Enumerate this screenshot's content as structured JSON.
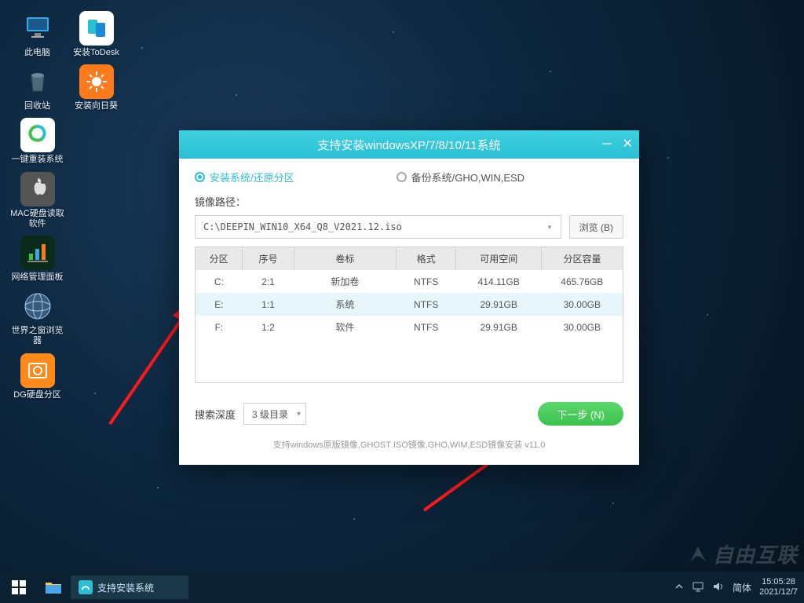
{
  "desktop_icons": [
    {
      "id": "pc",
      "label": "此电脑",
      "bg": "",
      "svg": "monitor"
    },
    {
      "id": "todesk",
      "label": "安装ToDesk",
      "bg": "#ffffff",
      "svg": "todesk"
    },
    {
      "id": "recycle",
      "label": "回收站",
      "bg": "",
      "svg": "bin"
    },
    {
      "id": "sunflower",
      "label": "安装向日葵",
      "bg": "#ff7a1a",
      "svg": "sun"
    },
    {
      "id": "reinstall",
      "label": "一键重装系统",
      "bg": "#ffffff",
      "svg": "swirl"
    },
    {
      "id": "",
      "label": "",
      "bg": "",
      "svg": ""
    },
    {
      "id": "macdisk",
      "label": "MAC硬盘读取软件",
      "bg": "#555",
      "svg": "apple"
    },
    {
      "id": "",
      "label": "",
      "bg": "",
      "svg": ""
    },
    {
      "id": "netpanel",
      "label": "网络管理面板",
      "bg": "#0a2a1a",
      "svg": "bars"
    },
    {
      "id": "",
      "label": "",
      "bg": "",
      "svg": ""
    },
    {
      "id": "browser",
      "label": "世界之窗浏览器",
      "bg": "",
      "svg": "globe"
    },
    {
      "id": "",
      "label": "",
      "bg": "",
      "svg": ""
    },
    {
      "id": "dg",
      "label": "DG硬盘分区",
      "bg": "#ff8a1a",
      "svg": "dg"
    }
  ],
  "dialog": {
    "title": "支持安装windowsXP/7/8/10/11系统",
    "radio_install": "安装系统/还原分区",
    "radio_backup": "备份系统/GHO,WIN,ESD",
    "path_label": "镜像路径：",
    "path_value": "C:\\DEEPIN_WIN10_X64_Q8_V2021.12.iso",
    "browse": "浏览 (B)",
    "headers": [
      "分区",
      "序号",
      "卷标",
      "格式",
      "可用空间",
      "分区容量"
    ],
    "rows": [
      {
        "drive": "C:",
        "idx": "2:1",
        "vol": "新加卷",
        "fmt": "NTFS",
        "free": "414.11GB",
        "cap": "465.76GB"
      },
      {
        "drive": "E:",
        "idx": "1:1",
        "vol": "系统",
        "fmt": "NTFS",
        "free": "29.91GB",
        "cap": "30.00GB"
      },
      {
        "drive": "F:",
        "idx": "1:2",
        "vol": "软件",
        "fmt": "NTFS",
        "free": "29.91GB",
        "cap": "30.00GB"
      }
    ],
    "depth_label": "搜索深度",
    "depth_value": "3 级目录",
    "next": "下一步 (N)",
    "foot": "支持windows原版镜像,GHOST ISO镜像,GHO,WIM,ESD镜像安装 v11.0"
  },
  "taskbar": {
    "task_label": "支持安装系统",
    "ime": "简体",
    "time": "15:05:28",
    "date": "2021/12/7"
  },
  "watermark": "自由互联"
}
